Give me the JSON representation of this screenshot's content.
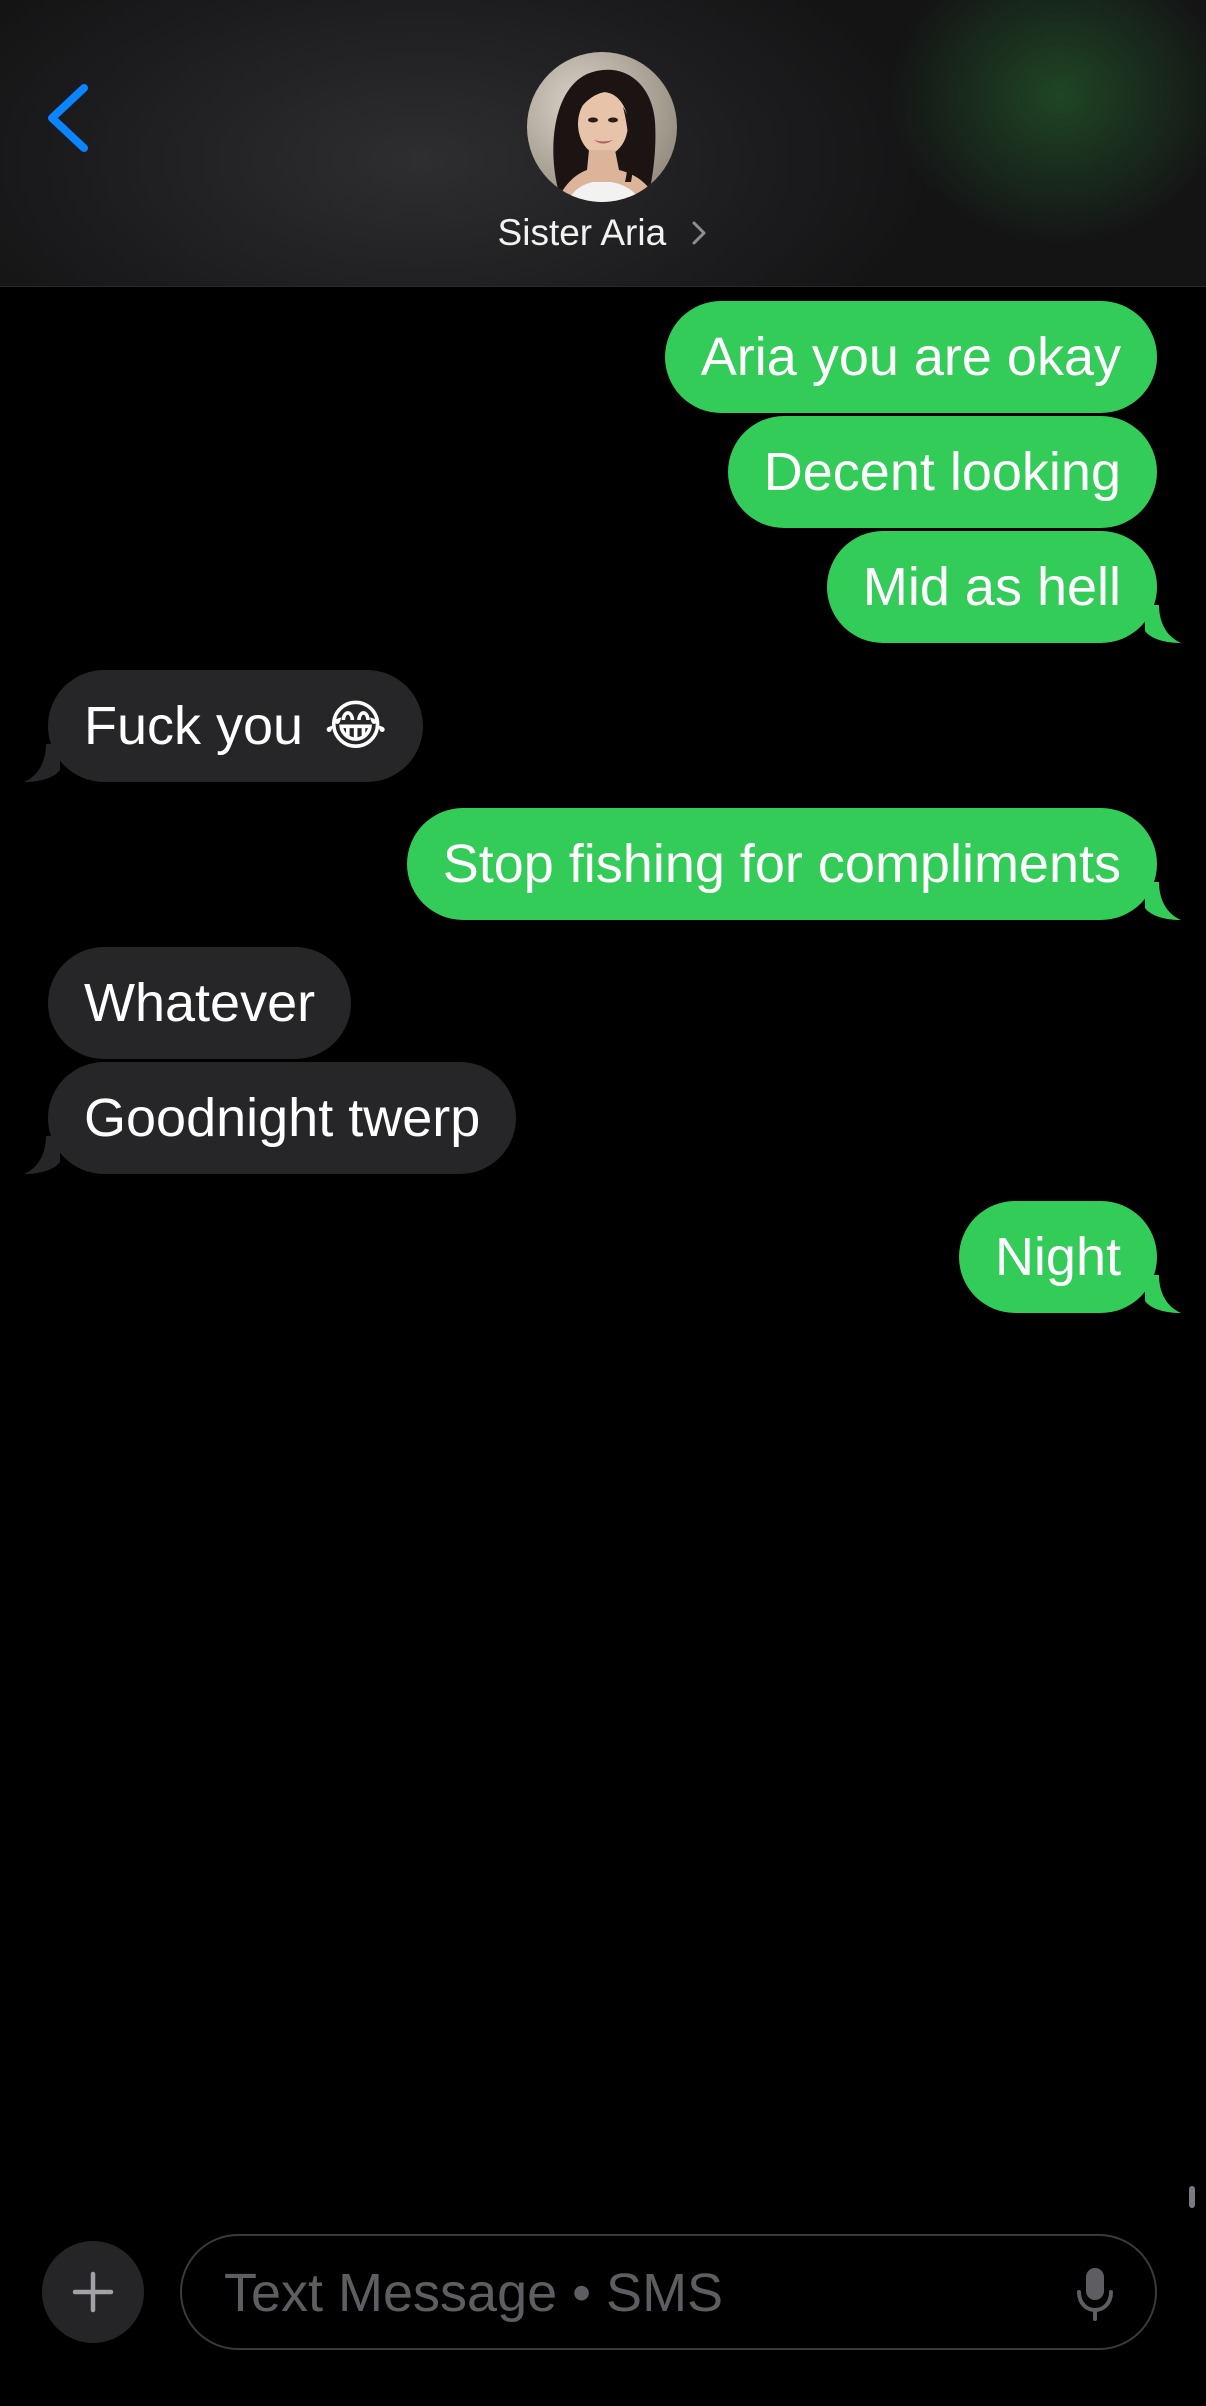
{
  "header": {
    "back_icon": "chevron-left-icon",
    "contact_name": "Sister Aria",
    "contact_chevron_icon": "chevron-right-icon",
    "avatar_icon": "contact-photo"
  },
  "colors": {
    "sent_bubble": "#33cc59",
    "received_bubble": "#262629",
    "accent": "#0a84ff",
    "background": "#000000"
  },
  "messages": [
    {
      "direction": "sent",
      "text": "Aria you are okay"
    },
    {
      "direction": "sent",
      "text": "Decent looking"
    },
    {
      "direction": "sent",
      "text": "Mid as hell"
    },
    {
      "direction": "received",
      "text": "Fuck you",
      "emoji": "😂"
    },
    {
      "direction": "sent",
      "text": "Stop fishing for compliments"
    },
    {
      "direction": "received",
      "text": "Whatever"
    },
    {
      "direction": "received",
      "text": "Goodnight twerp"
    },
    {
      "direction": "sent",
      "text": "Night"
    }
  ],
  "composer": {
    "plus_icon": "plus-icon",
    "placeholder": "Text Message • SMS",
    "value": "",
    "mic_icon": "microphone-icon"
  }
}
